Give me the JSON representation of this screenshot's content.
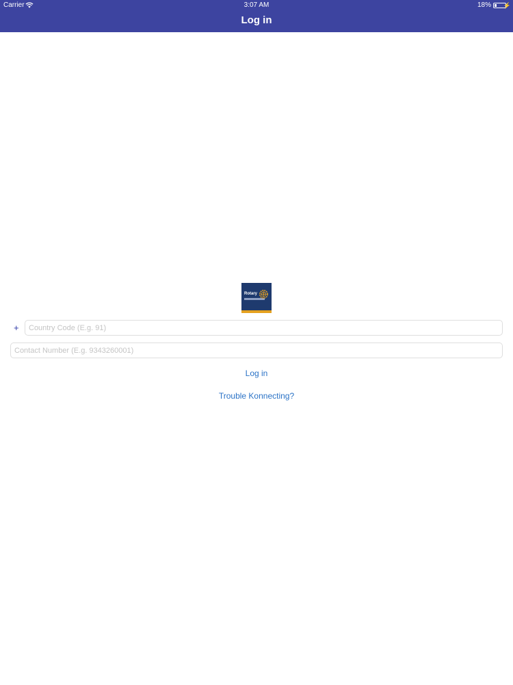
{
  "status_bar": {
    "carrier": "Carrier",
    "time": "3:07 AM",
    "battery": "18%"
  },
  "nav": {
    "title": "Log in"
  },
  "logo": {
    "brand": "Rotary"
  },
  "form": {
    "country_prefix": "+",
    "country_placeholder": "Country Code (E.g. 91)",
    "contact_placeholder": "Contact Number (E.g. 9343260001)",
    "login_label": "Log in",
    "trouble_label": "Trouble Konnecting?"
  },
  "colors": {
    "nav_background": "#3d44a0",
    "link": "#2a72c6",
    "logo_background": "#1e3a6e",
    "logo_stripe": "#e5a120"
  }
}
